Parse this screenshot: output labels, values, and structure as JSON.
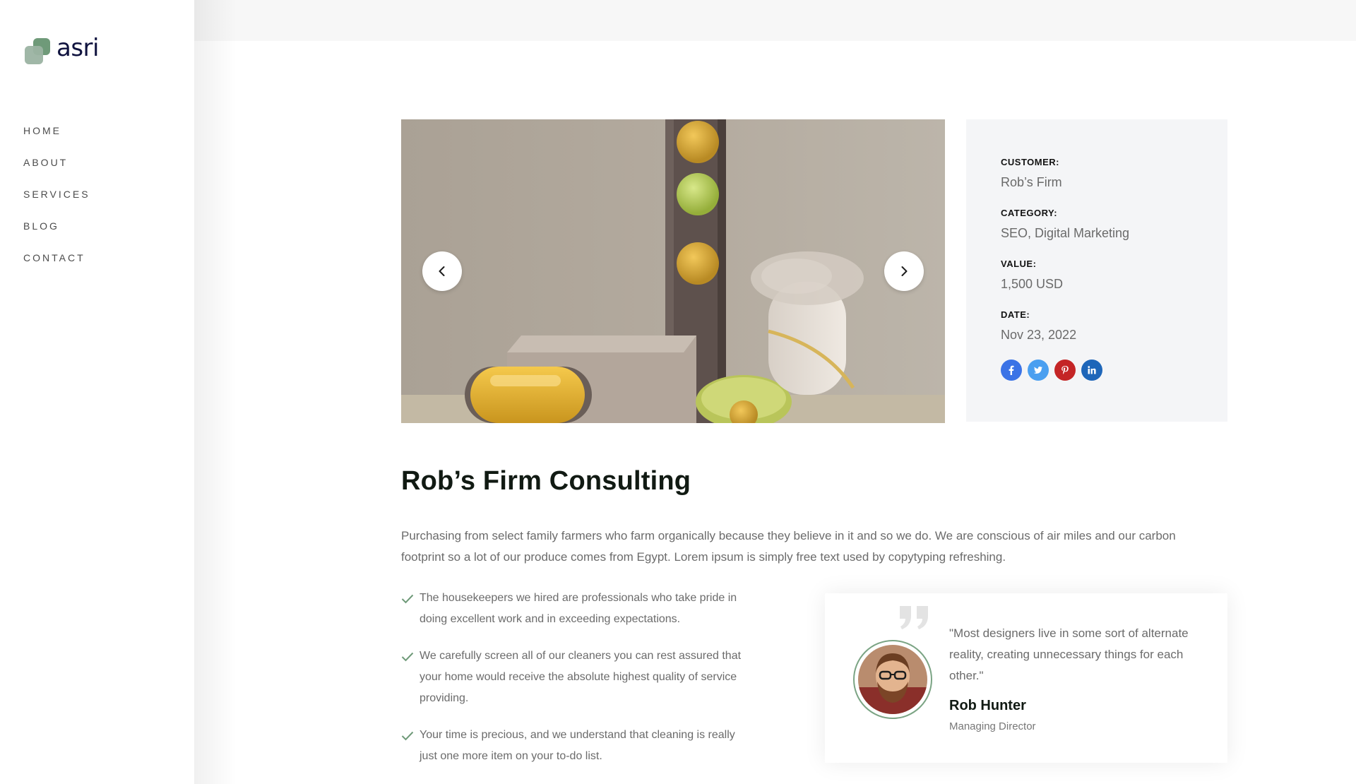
{
  "brand": {
    "name": "asri",
    "colors": {
      "accent": "#6f9a79",
      "navy": "#10133f"
    }
  },
  "nav": {
    "items": [
      "HOME",
      "ABOUT",
      "SERVICES",
      "BLOG",
      "CONTACT"
    ]
  },
  "slider": {
    "prev_icon": "chevron-left-icon",
    "next_icon": "chevron-right-icon"
  },
  "info": {
    "customer_label": "CUSTOMER:",
    "customer_value": "Rob’s Firm",
    "category_label": "CATEGORY:",
    "category_value": "SEO, Digital Marketing",
    "value_label": "VALUE:",
    "value_value": "1,500 USD",
    "date_label": "DATE:",
    "date_value": "Nov 23, 2022",
    "socials": [
      "facebook-icon",
      "twitter-icon",
      "pinterest-icon",
      "linkedin-icon"
    ]
  },
  "content": {
    "title": "Rob’s Firm Consulting",
    "lead": "Purchasing from select family farmers who farm organically because they believe in it and so we do. We are conscious of air miles and our carbon footprint so a lot of our produce comes from Egypt. Lorem ipsum is simply free text used by copytyping refreshing.",
    "checks": [
      "The housekeepers we hired are professionals who take pride in doing excellent work and in exceeding expectations.",
      "We carefully screen all of our cleaners you can rest assured that your home would receive the absolute highest quality of service providing.",
      "Your time is precious, and we understand that cleaning is really just one more item on your to-do list."
    ]
  },
  "testimonial": {
    "quote": "\"Most designers live in some sort of alternate reality, creating unnecessary things for each other.\"",
    "name": "Rob Hunter",
    "role": "Managing Director"
  }
}
